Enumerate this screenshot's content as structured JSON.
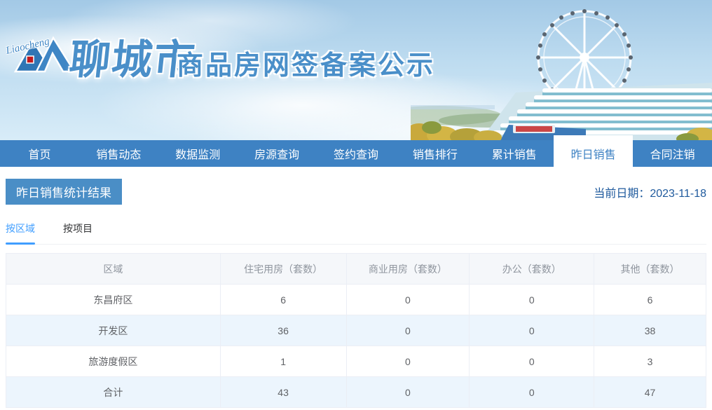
{
  "header": {
    "logo_script": "Liaocheng",
    "city_name": "聊城市",
    "site_title": "商品房网签备案公示"
  },
  "nav": {
    "items": [
      {
        "label": "首页",
        "active": false
      },
      {
        "label": "销售动态",
        "active": false
      },
      {
        "label": "数据监测",
        "active": false
      },
      {
        "label": "房源查询",
        "active": false
      },
      {
        "label": "签约查询",
        "active": false
      },
      {
        "label": "销售排行",
        "active": false
      },
      {
        "label": "累计销售",
        "active": false
      },
      {
        "label": "昨日销售",
        "active": true
      },
      {
        "label": "合同注销",
        "active": false
      }
    ]
  },
  "page": {
    "section_title": "昨日销售统计结果",
    "current_date_label": "当前日期：",
    "current_date_value": "2023-11-18"
  },
  "tabs": [
    {
      "label": "按区域",
      "active": true
    },
    {
      "label": "按项目",
      "active": false
    }
  ],
  "table": {
    "columns": [
      "区域",
      "住宅用房（套数）",
      "商业用房（套数）",
      "办公（套数）",
      "其他（套数）"
    ],
    "rows": [
      {
        "region": "东昌府区",
        "values": [
          "6",
          "0",
          "0",
          "6"
        ]
      },
      {
        "region": "开发区",
        "values": [
          "36",
          "0",
          "0",
          "38"
        ]
      },
      {
        "region": "旅游度假区",
        "values": [
          "1",
          "0",
          "0",
          "3"
        ]
      },
      {
        "region": "合计",
        "values": [
          "43",
          "0",
          "0",
          "47"
        ]
      }
    ]
  },
  "colors": {
    "nav_blue": "#3e82c3",
    "badge_blue": "#4a8ec6",
    "tab_active_blue": "#409eff",
    "date_blue": "#1f5a9d",
    "stripe_blue": "#ecf5fd",
    "header_gray": "#f5f7fa"
  }
}
